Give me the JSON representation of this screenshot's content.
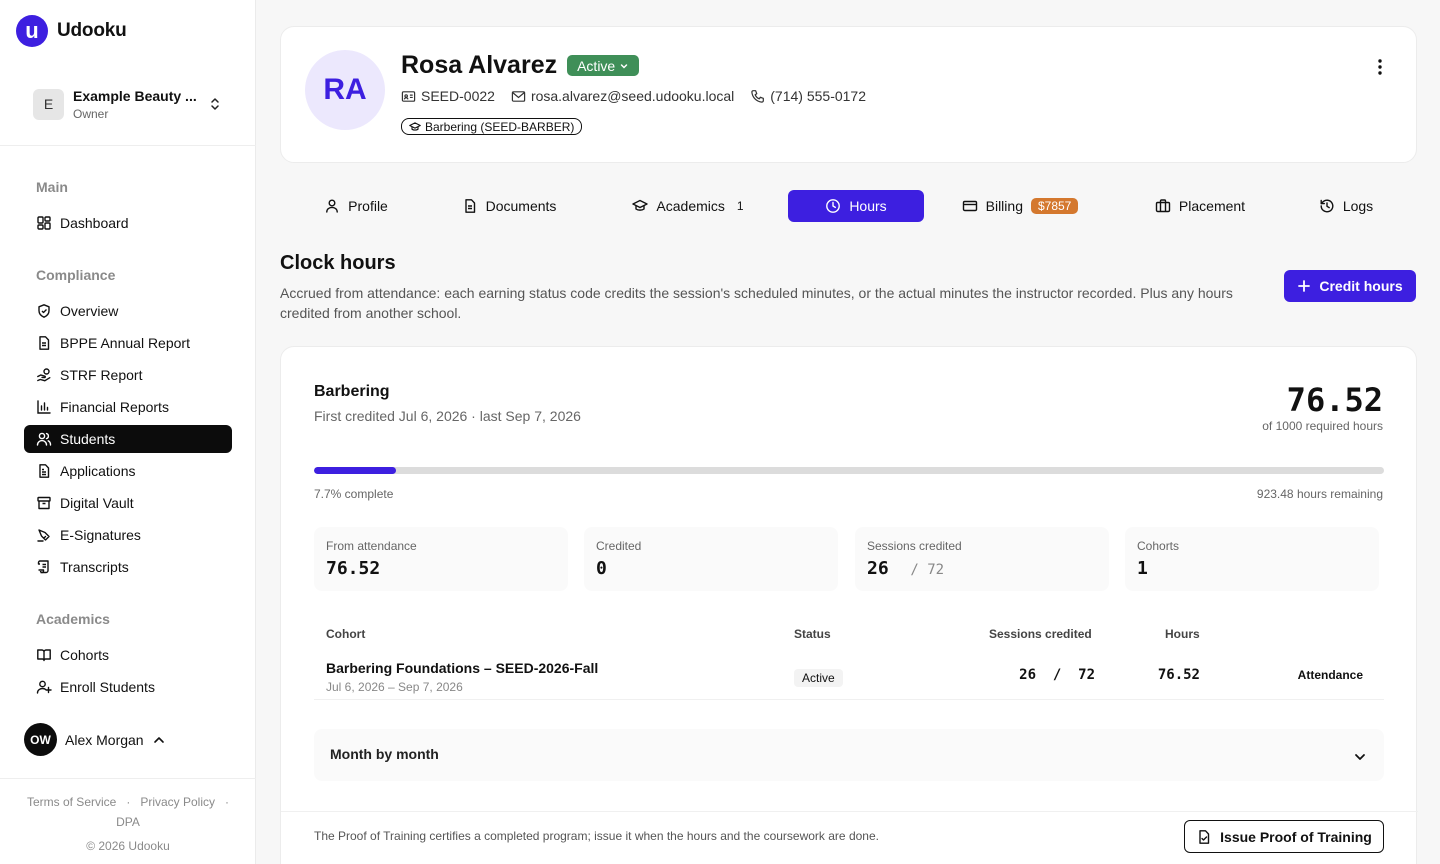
{
  "app": {
    "name": "Udooku",
    "logo_letter": "u"
  },
  "org": {
    "initial": "E",
    "name": "Example Beauty ...",
    "role": "Owner"
  },
  "sidebar": {
    "sections": [
      {
        "heading": "Main",
        "items": [
          {
            "label": "Dashboard",
            "icon": "dashboard-icon"
          }
        ]
      },
      {
        "heading": "Compliance",
        "items": [
          {
            "label": "Overview",
            "icon": "shield-icon"
          },
          {
            "label": "BPPE Annual Report",
            "icon": "document-icon"
          },
          {
            "label": "STRF Report",
            "icon": "hand-coins-icon"
          },
          {
            "label": "Financial Reports",
            "icon": "bar-chart-icon"
          },
          {
            "label": "Students",
            "icon": "users-icon",
            "active": true
          },
          {
            "label": "Applications",
            "icon": "file-text-icon"
          },
          {
            "label": "Digital Vault",
            "icon": "archive-icon"
          },
          {
            "label": "E-Signatures",
            "icon": "signature-icon"
          },
          {
            "label": "Transcripts",
            "icon": "scroll-icon"
          }
        ]
      },
      {
        "heading": "Academics",
        "items": [
          {
            "label": "Cohorts",
            "icon": "book-open-icon"
          },
          {
            "label": "Enroll Students",
            "icon": "user-plus-icon"
          }
        ]
      }
    ]
  },
  "user": {
    "initials": "OW",
    "name": "Alex Morgan"
  },
  "footer": {
    "terms": "Terms of Service",
    "privacy": "Privacy Policy",
    "dpa": "DPA",
    "copyright": "© 2026 Udooku"
  },
  "student": {
    "initials": "RA",
    "name": "Rosa Alvarez",
    "status": "Active",
    "id": "SEED-0022",
    "email": "rosa.alvarez@seed.udooku.local",
    "phone": "(714) 555-0172",
    "program": "Barbering (SEED-BARBER)"
  },
  "tabs": [
    {
      "label": "Profile",
      "icon": "user-icon"
    },
    {
      "label": "Documents",
      "icon": "document-icon"
    },
    {
      "label": "Academics",
      "icon": "graduation-cap-icon",
      "count": "1"
    },
    {
      "label": "Hours",
      "icon": "clock-icon",
      "active": true
    },
    {
      "label": "Billing",
      "icon": "credit-card-icon",
      "badge": "$7857"
    },
    {
      "label": "Placement",
      "icon": "briefcase-icon"
    },
    {
      "label": "Logs",
      "icon": "history-icon"
    }
  ],
  "hours": {
    "title": "Clock hours",
    "description": "Accrued from attendance: each earning status code credits the session's scheduled minutes, or the actual minutes the instructor recorded. Plus any hours credited from another school.",
    "credit_button": "Credit hours",
    "program": {
      "name": "Barbering",
      "dates": "First credited Jul 6, 2026 · last Sep 7, 2026",
      "total": "76.52",
      "required": "of 1000 required hours",
      "progress": 0.077,
      "percent_label": "7.7% complete",
      "remaining": "923.48 hours remaining"
    },
    "stats": [
      {
        "label": "From attendance",
        "value": "76.52"
      },
      {
        "label": "Credited",
        "value": "0"
      },
      {
        "label": "Sessions credited",
        "value": "26",
        "sub": "/ 72"
      },
      {
        "label": "Cohorts",
        "value": "1"
      }
    ],
    "table": {
      "headers": {
        "cohort": "Cohort",
        "status": "Status",
        "sessions": "Sessions credited",
        "hours": "Hours"
      },
      "rows": [
        {
          "name": "Barbering Foundations – SEED-2026-Fall",
          "dates": "Jul 6, 2026 – Sep 7, 2026",
          "status": "Active",
          "sessions": "26  /  72",
          "hours": "76.52",
          "source": "Attendance"
        }
      ]
    },
    "month_label": "Month by month",
    "proof_text": "The Proof of Training certifies a completed program; issue it when the hours and the coursework are done.",
    "proof_button": "Issue Proof of Training"
  },
  "colors": {
    "accent": "#3d1fe0",
    "active_status": "#3f8f58",
    "billing_badge": "#d4782e"
  }
}
